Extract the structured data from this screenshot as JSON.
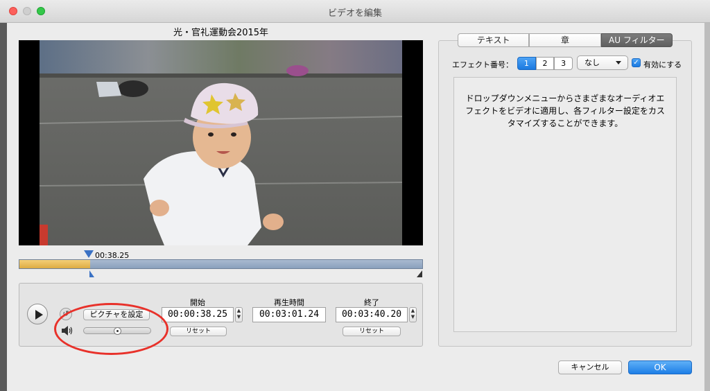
{
  "window": {
    "title": "ビデオを編集"
  },
  "preview": {
    "video_title": "光・官礼運動会2015年"
  },
  "timeline": {
    "current_time": "00:38.25",
    "played_fraction": 0.175
  },
  "controls": {
    "picture_button": "ピクチャを設定",
    "volume_level": 0.5,
    "start": {
      "label": "開始",
      "value": "00:00:38.25",
      "reset": "リセット"
    },
    "duration": {
      "label": "再生時間",
      "value": "00:03:01.24"
    },
    "end": {
      "label": "終了",
      "value": "00:03:40.20",
      "reset": "リセット"
    }
  },
  "tabs": [
    {
      "label": "テキスト",
      "active": false
    },
    {
      "label": "章",
      "active": false
    },
    {
      "label": "AU フィルター",
      "active": true
    }
  ],
  "effects": {
    "label": "エフェクト番号：",
    "numbers": [
      "1",
      "2",
      "3"
    ],
    "selected_number": "1",
    "select_value": "なし",
    "enable_checked": true,
    "enable_label": "有効にする",
    "description": "ドロップダウンメニューからさまざまなオーディオエフェクトをビデオに適用し、各フィルター設定をカスタマイズすることができます。"
  },
  "footer": {
    "cancel": "キャンセル",
    "ok": "OK"
  },
  "colors": {
    "accent": "#1a79e0",
    "annotation": "#e8312a",
    "timeline_fill": "#deab43"
  }
}
